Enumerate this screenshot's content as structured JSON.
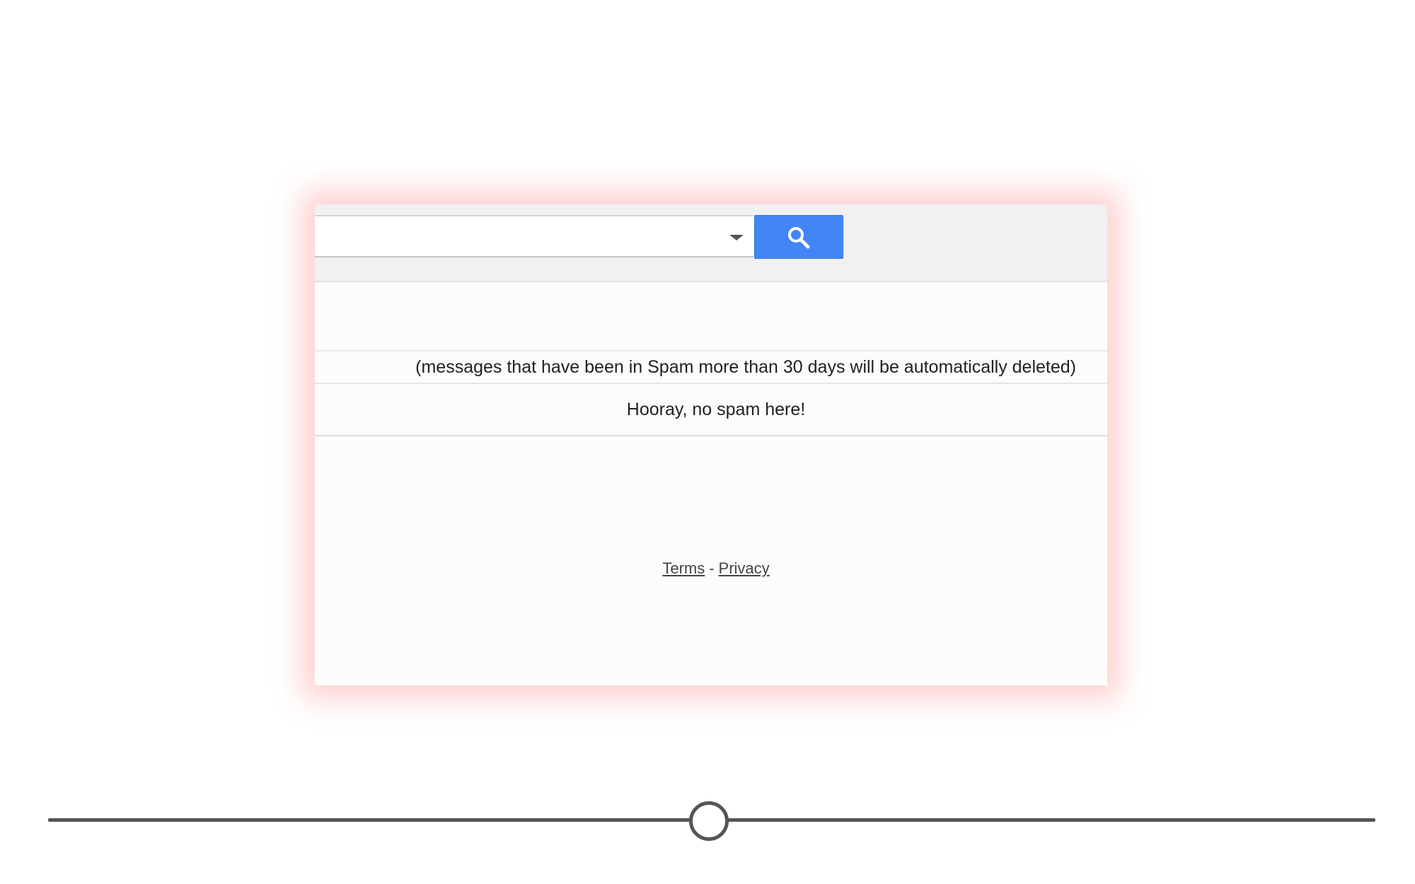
{
  "search": {
    "placeholder": "",
    "options_icon": "chevron-down-icon",
    "button_icon": "search-icon",
    "button_color": "#4285f4"
  },
  "spam_notice": "(messages that have been in Spam more than 30 days will be automatically deleted)",
  "empty_message": "Hooray, no spam here!",
  "footer": {
    "terms": "Terms",
    "separator": "-",
    "privacy": "Privacy"
  },
  "slider": {
    "value_percent": 49.7
  },
  "colors": {
    "panel_glow": "#ff9696",
    "slider": "#555555"
  }
}
